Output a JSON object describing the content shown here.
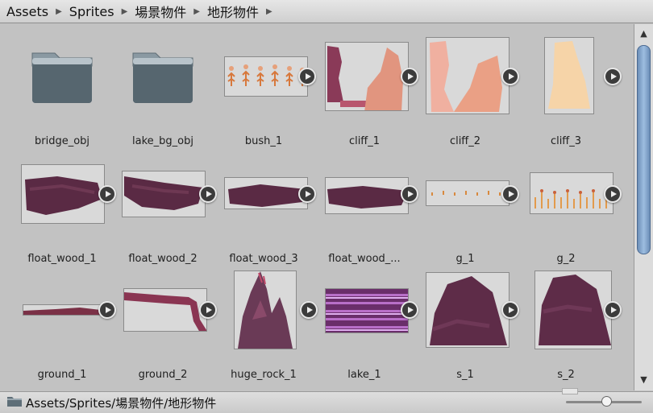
{
  "breadcrumb": [
    "Assets",
    "Sprites",
    "場景物件",
    "地形物件"
  ],
  "status_path": "Assets/Sprites/場景物件/地形物件",
  "colors": {
    "accent": "#7a9cc6",
    "folder": "#5d6d77",
    "rock": "#6a3a56"
  },
  "assets": [
    {
      "label": "bridge_obj",
      "kind": "folder"
    },
    {
      "label": "lake_bg_obj",
      "kind": "folder"
    },
    {
      "label": "bush_1",
      "kind": "sprite"
    },
    {
      "label": "cliff_1",
      "kind": "sprite"
    },
    {
      "label": "cliff_2",
      "kind": "sprite"
    },
    {
      "label": "cliff_3",
      "kind": "sprite"
    },
    {
      "label": "float_wood_1",
      "kind": "sprite"
    },
    {
      "label": "float_wood_2",
      "kind": "sprite"
    },
    {
      "label": "float_wood_3",
      "kind": "sprite"
    },
    {
      "label": "float_wood_...",
      "kind": "sprite"
    },
    {
      "label": "g_1",
      "kind": "sprite"
    },
    {
      "label": "g_2",
      "kind": "sprite"
    },
    {
      "label": "ground_1",
      "kind": "sprite"
    },
    {
      "label": "ground_2",
      "kind": "sprite"
    },
    {
      "label": "huge_rock_1",
      "kind": "sprite"
    },
    {
      "label": "lake_1",
      "kind": "sprite"
    },
    {
      "label": "s_1",
      "kind": "sprite"
    },
    {
      "label": "s_2",
      "kind": "sprite"
    }
  ]
}
